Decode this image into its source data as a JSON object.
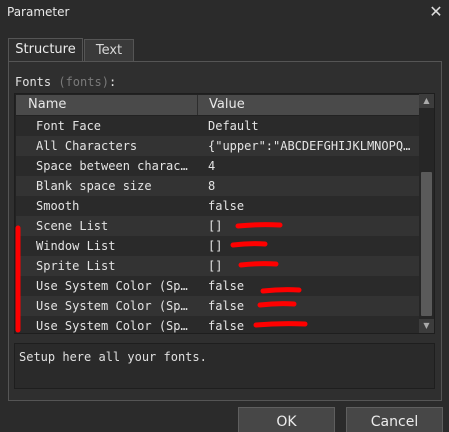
{
  "window": {
    "title": "Parameter",
    "close_glyph": "✕"
  },
  "tabs": [
    {
      "label": "Structure",
      "active": true
    },
    {
      "label": "Text",
      "active": false
    }
  ],
  "fonts_label": {
    "name": "Fonts",
    "code": "(fonts)",
    "suffix": ":"
  },
  "list": {
    "columns": {
      "name": "Name",
      "value": "Value"
    },
    "rows": [
      {
        "name": "Font Face",
        "value": "Default"
      },
      {
        "name": "All Characters",
        "value": "{\"upper\":\"ABCDEFGHIJKLMNOPQ…"
      },
      {
        "name": "Space between charac…",
        "value": "4"
      },
      {
        "name": "Blank space size",
        "value": "8"
      },
      {
        "name": "Smooth",
        "value": "false"
      },
      {
        "name": "Scene List",
        "value": "[]"
      },
      {
        "name": "Window List",
        "value": "[]"
      },
      {
        "name": "Sprite List",
        "value": "[]"
      },
      {
        "name": "Use System Color (Sp…",
        "value": "false"
      },
      {
        "name": "Use System Color (Sp…",
        "value": "false"
      },
      {
        "name": "Use System Color (Sp…",
        "value": "false"
      }
    ]
  },
  "description": "Setup here all your fonts.",
  "buttons": {
    "ok": "OK",
    "cancel": "Cancel"
  },
  "colors": {
    "annotation_red": "#ff0000"
  },
  "icons": {
    "close": "close-icon",
    "scroll_up": "scroll-up-icon",
    "scroll_down": "scroll-down-icon"
  }
}
